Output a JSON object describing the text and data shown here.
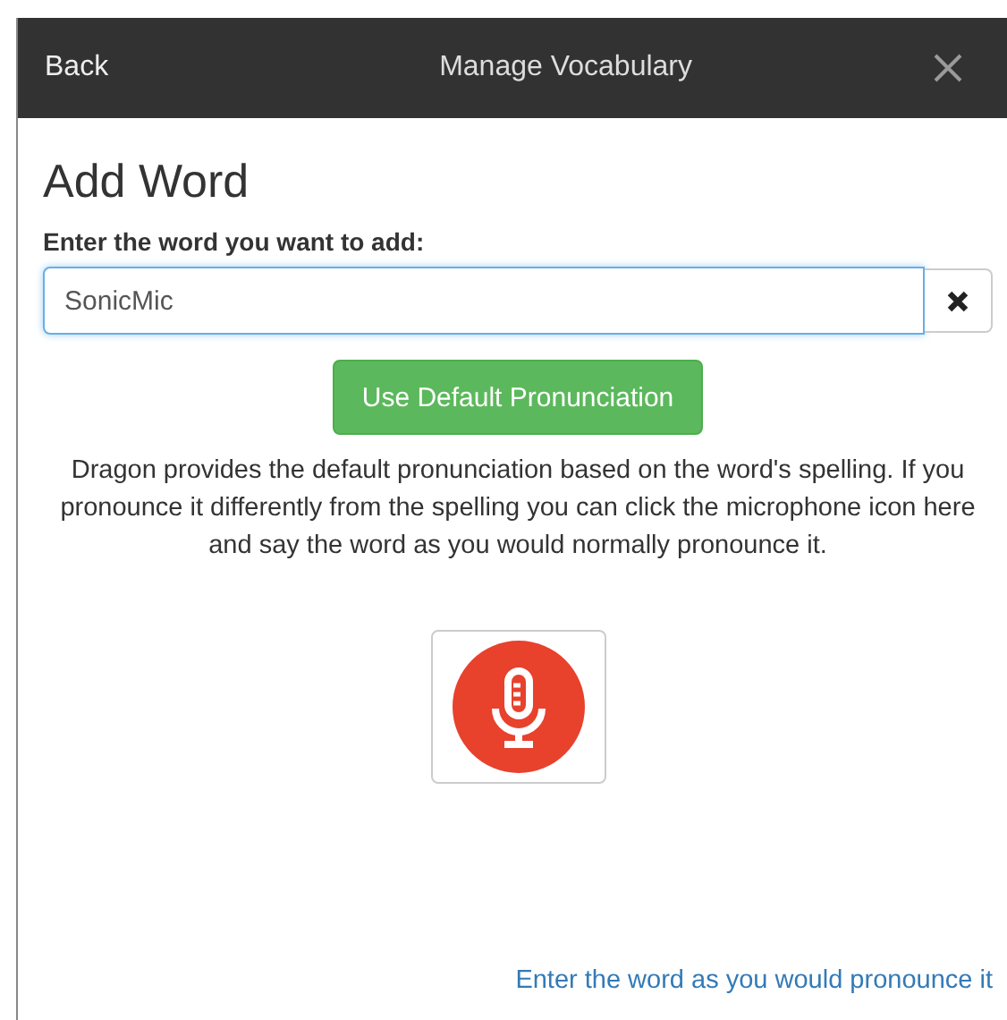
{
  "header": {
    "back": "Back",
    "title": "Manage Vocabulary"
  },
  "heading": "Add Word",
  "field": {
    "label": "Enter the word you want to add:",
    "value": "SonicMic",
    "focused": true
  },
  "default_button": "Use Default Pronunciation",
  "description": "Dragon provides the default pronunciation based on the word's spelling. If you pronounce it differently from the spelling you can click the microphone icon here and say the word as you would normally pronounce it.",
  "link": "Enter the word as you would pronounce it"
}
